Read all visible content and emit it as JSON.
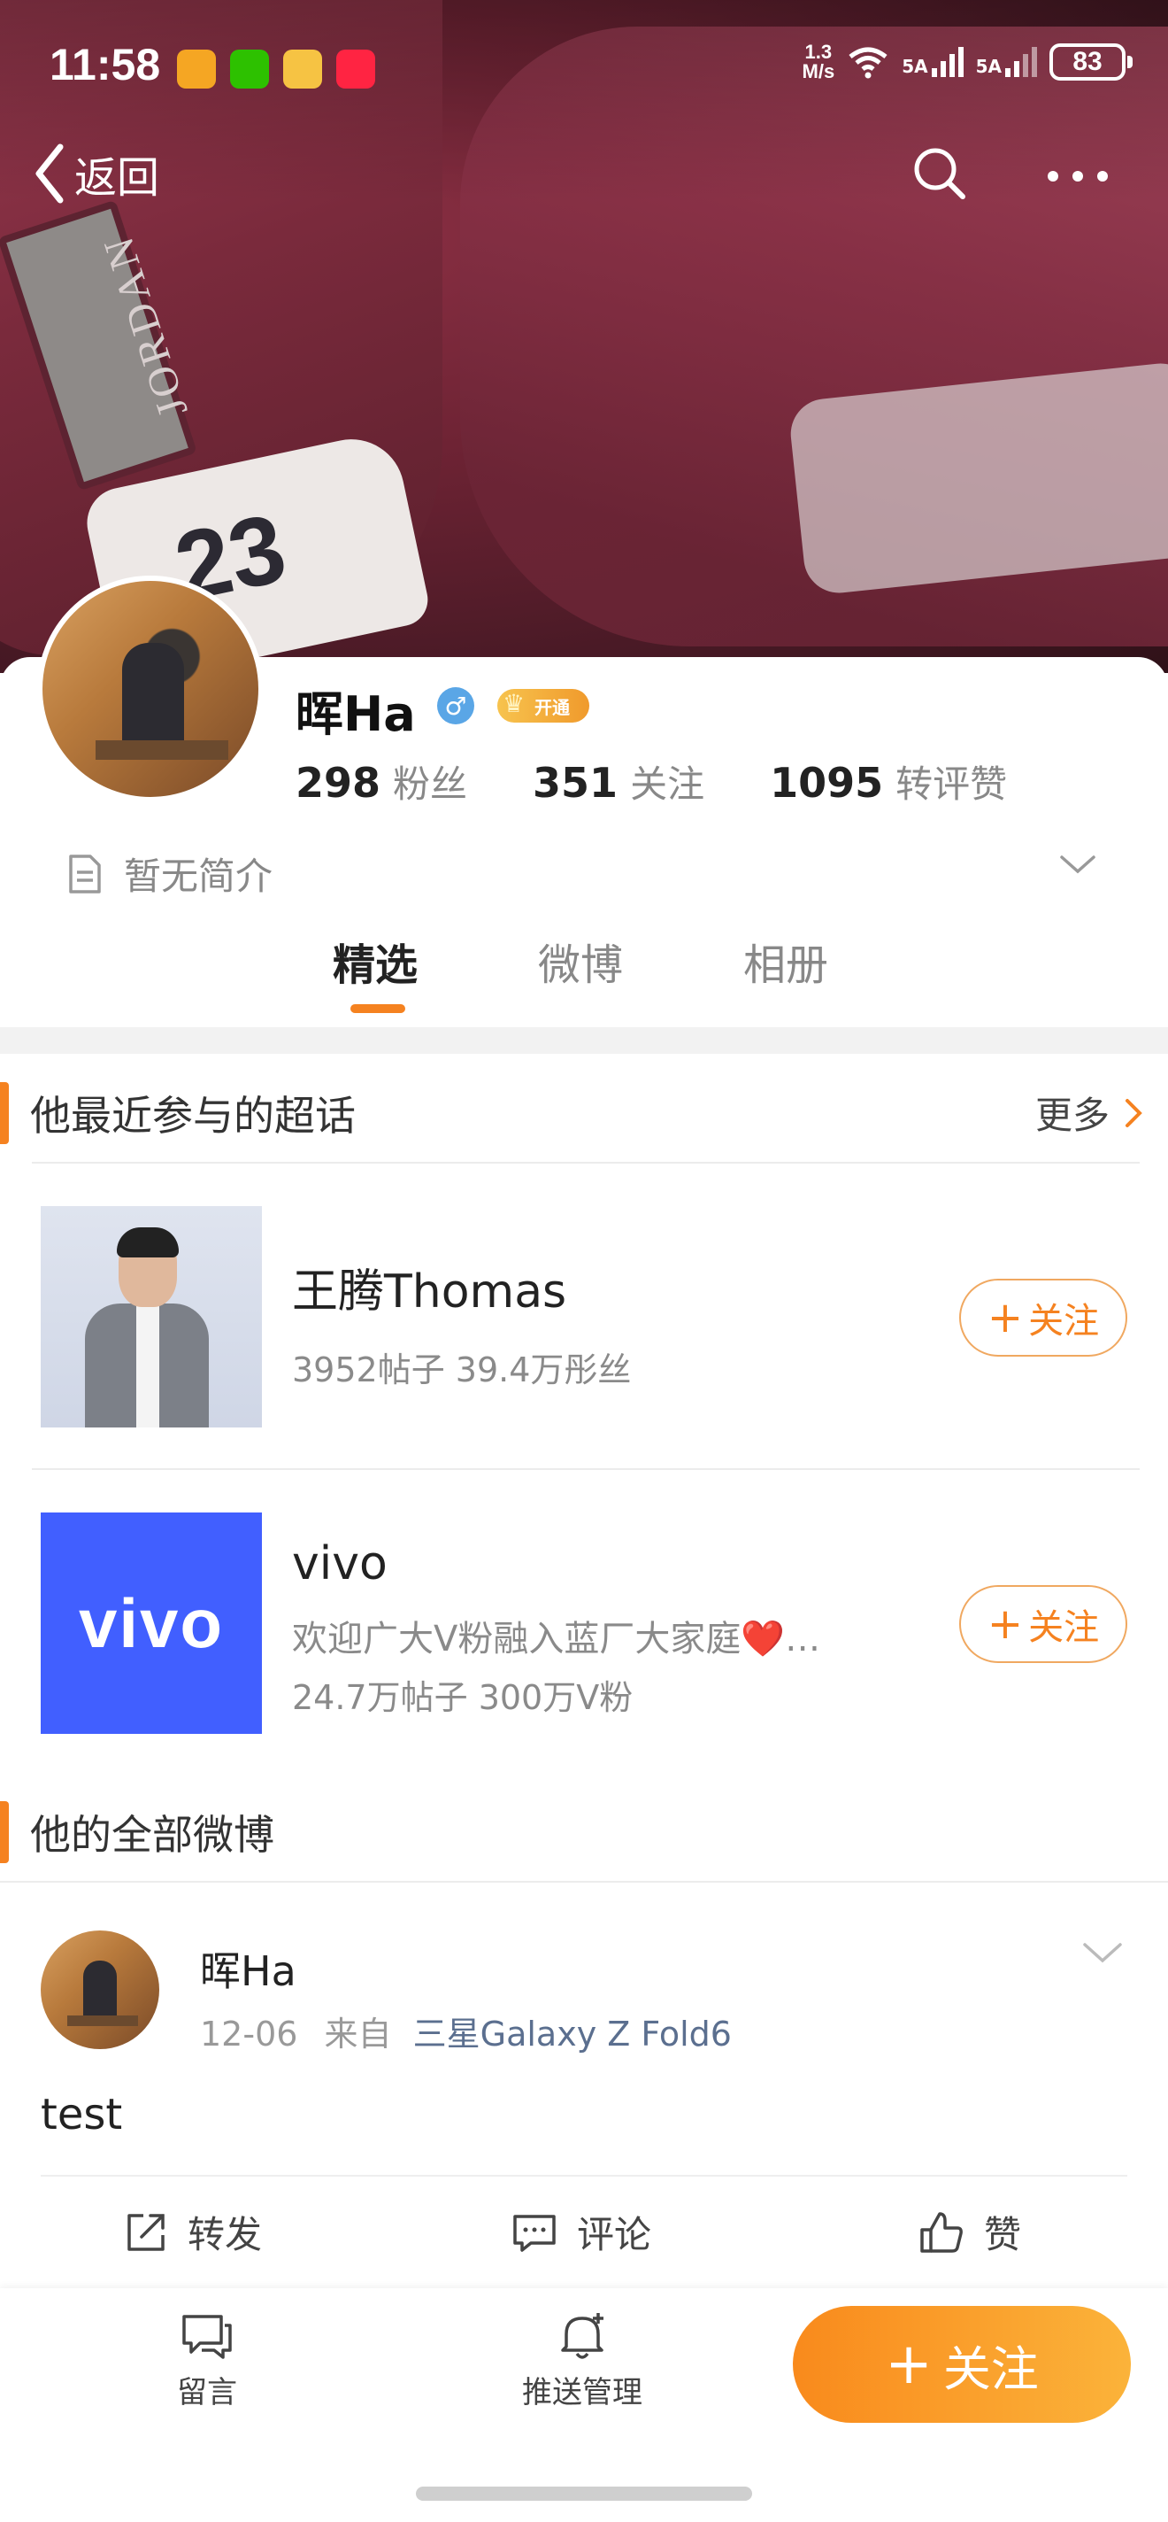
{
  "status_bar": {
    "time": "11:58",
    "net_speed_value": "1.3",
    "net_speed_unit": "M/s",
    "signal_1": "5A",
    "signal_2": "5A",
    "battery": "83"
  },
  "nav": {
    "back_label": "返回"
  },
  "profile": {
    "username": "晖Ha",
    "gender": "♂",
    "vip_label": "开通",
    "stats": [
      {
        "value": "298",
        "label": "粉丝"
      },
      {
        "value": "351",
        "label": "关注"
      },
      {
        "value": "1095",
        "label": "转评赞"
      }
    ],
    "bio": "暂无简介"
  },
  "tabs": [
    "精选",
    "微博",
    "相册"
  ],
  "active_tab": "精选",
  "super_topics": {
    "title": "他最近参与的超话",
    "more_label": "更多",
    "items": [
      {
        "name": "王腾Thomas",
        "stats": "3952帖子 39.4万彤丝",
        "follow_label": "关注"
      },
      {
        "name": "vivo",
        "intro": "欢迎广大V粉融入蓝厂大家庭❤️…",
        "stats": "24.7万帖子 300万V粉",
        "follow_label": "关注",
        "logo_text": "vivo"
      }
    ]
  },
  "all_posts": {
    "title": "他的全部微博",
    "post": {
      "user": "晖Ha",
      "date": "12-06",
      "from_label": "来自",
      "source": "三星Galaxy Z Fold6",
      "text": "test",
      "actions": {
        "repost": "转发",
        "comment": "评论",
        "like": "赞"
      }
    }
  },
  "bottom_bar": {
    "message": "留言",
    "push": "推送管理",
    "follow": "关注"
  },
  "colors": {
    "accent": "#f58220",
    "link": "#5b6f8f",
    "vivo_blue": "#415fff"
  }
}
